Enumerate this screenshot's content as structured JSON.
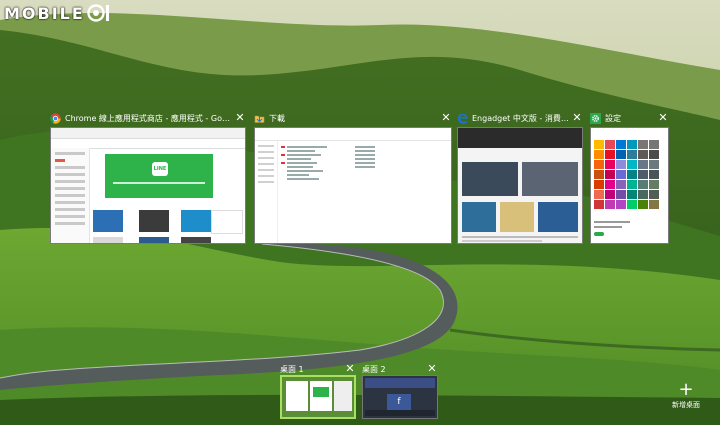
{
  "watermark": {
    "text": "MOBILE"
  },
  "windows": [
    {
      "id": "chrome",
      "icon": "chrome-icon",
      "title": "Chrome 線上應用程式商店 - 應用程式 - Google Chr...",
      "close": "✕"
    },
    {
      "id": "explorer",
      "icon": "folder-icon",
      "title": "下載",
      "close": "✕"
    },
    {
      "id": "edge",
      "icon": "edge-icon",
      "title": "Engadget 中文版 - 消費性電...",
      "close": "✕"
    },
    {
      "id": "settings",
      "icon": "gear-icon",
      "title": "設定",
      "close": "✕"
    }
  ],
  "chrome_thumb": {
    "banner_logo": "LINE"
  },
  "desktops": [
    {
      "label": "桌面 1",
      "close": "✕",
      "active": true
    },
    {
      "label": "桌面 2",
      "close": "✕",
      "active": false
    }
  ],
  "new_desktop": {
    "symbol": "+",
    "label": "新增桌面"
  },
  "colors": {
    "accent_active_desktop": "#a8e063",
    "line_green": "#2db34a",
    "settings_icon_bg": "#2aa84a",
    "edge_blue": "#1e73c9"
  }
}
